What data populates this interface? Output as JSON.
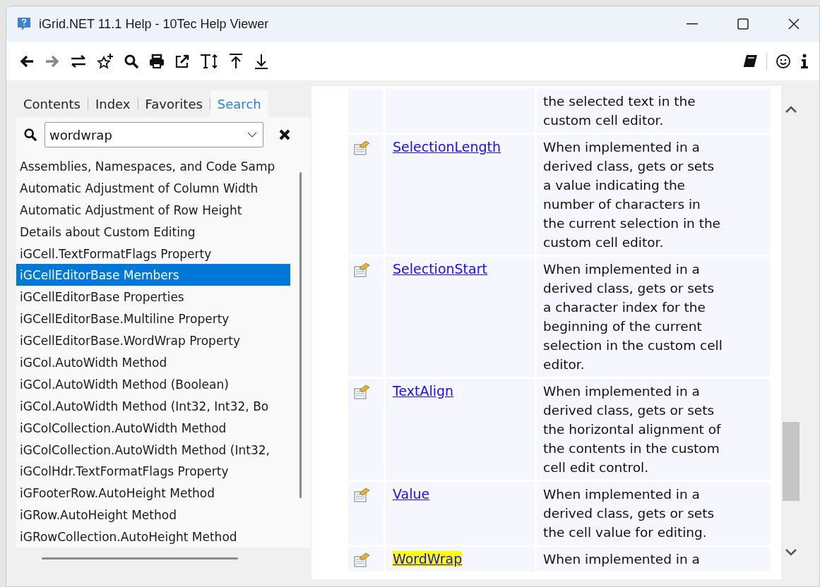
{
  "window": {
    "title": "iGrid.NET 11.1 Help - 10Tec Help Viewer"
  },
  "tabs": [
    {
      "label": "Contents",
      "selected": false
    },
    {
      "label": "Index",
      "selected": false
    },
    {
      "label": "Favorites",
      "selected": false
    },
    {
      "label": "Search",
      "selected": true
    }
  ],
  "search": {
    "value": "wordwrap"
  },
  "results": [
    {
      "label": "Assemblies, Namespaces, and Code Samp",
      "selected": false
    },
    {
      "label": "Automatic Adjustment of Column Width",
      "selected": false
    },
    {
      "label": "Automatic Adjustment of Row Height",
      "selected": false
    },
    {
      "label": "Details about Custom Editing",
      "selected": false
    },
    {
      "label": "iGCell.TextFormatFlags Property",
      "selected": false
    },
    {
      "label": "iGCellEditorBase Members",
      "selected": true
    },
    {
      "label": "iGCellEditorBase Properties",
      "selected": false
    },
    {
      "label": "iGCellEditorBase.Multiline Property",
      "selected": false
    },
    {
      "label": "iGCellEditorBase.WordWrap Property",
      "selected": false
    },
    {
      "label": "iGCol.AutoWidth Method",
      "selected": false
    },
    {
      "label": "iGCol.AutoWidth Method (Boolean)",
      "selected": false
    },
    {
      "label": "iGCol.AutoWidth Method (Int32, Int32, Bo",
      "selected": false
    },
    {
      "label": "iGColCollection.AutoWidth Method",
      "selected": false
    },
    {
      "label": "iGColCollection.AutoWidth Method (Int32,",
      "selected": false
    },
    {
      "label": "iGColHdr.TextFormatFlags Property",
      "selected": false
    },
    {
      "label": "iGFooterRow.AutoHeight Method",
      "selected": false
    },
    {
      "label": "iGRow.AutoHeight Method",
      "selected": false
    },
    {
      "label": "iGRowCollection.AutoHeight Method",
      "selected": false
    }
  ],
  "members": [
    {
      "description": [
        "the selected text in the",
        "custom cell editor."
      ]
    },
    {
      "name": "SelectionLength",
      "highlighted": false,
      "description": [
        "When implemented in a",
        "derived class, gets or sets",
        "a value indicating the",
        "number of characters in",
        "the current selection in the",
        "custom cell editor."
      ]
    },
    {
      "name": "SelectionStart",
      "highlighted": false,
      "description": [
        "When implemented in a",
        "derived class, gets or sets",
        "a character index for the",
        "beginning of the current",
        "selection in the custom cell",
        "editor."
      ]
    },
    {
      "name": "TextAlign",
      "highlighted": false,
      "description": [
        "When implemented in a",
        "derived class, gets or sets",
        "the horizontal alignment of",
        "the contents in the custom",
        "cell edit control."
      ]
    },
    {
      "name": "Value",
      "highlighted": false,
      "description": [
        "When implemented in a",
        "derived class, gets or sets",
        "the cell value for editing."
      ]
    },
    {
      "name": "WordWrap",
      "highlighted": true,
      "description": [
        "When implemented in a"
      ]
    }
  ]
}
